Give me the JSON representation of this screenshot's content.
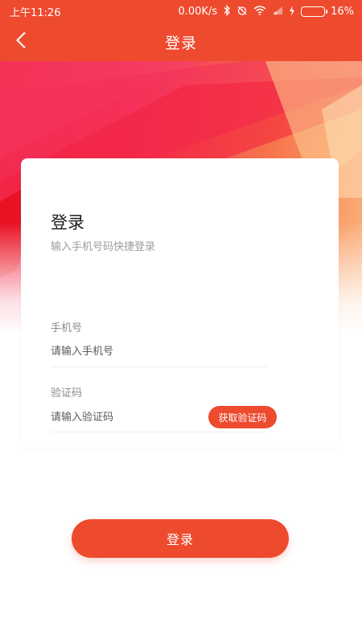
{
  "status_bar": {
    "time": "上午11:26",
    "network_speed": "0.00K/s",
    "battery_percent": "16%",
    "battery_level": 0.16,
    "icons": [
      "bluetooth-icon",
      "alarm-icon",
      "wifi-icon",
      "signal-icon",
      "charging-icon",
      "battery-icon"
    ]
  },
  "appbar": {
    "back_icon": "back-arrow-icon",
    "title": "登录"
  },
  "login_card": {
    "heading": "登录",
    "subtitle": "输入手机号码快捷登录",
    "phone": {
      "label": "手机号",
      "placeholder": "请输入手机号",
      "value": ""
    },
    "code": {
      "label": "验证码",
      "placeholder": "请输入验证码",
      "value": "",
      "get_code_label": "获取验证码"
    }
  },
  "submit_label": "登录",
  "colors": {
    "primary": "#ee4a2e",
    "hero_start": "#f0213f",
    "hero_end": "#fbb67d",
    "battery_fill": "#55d65a"
  }
}
